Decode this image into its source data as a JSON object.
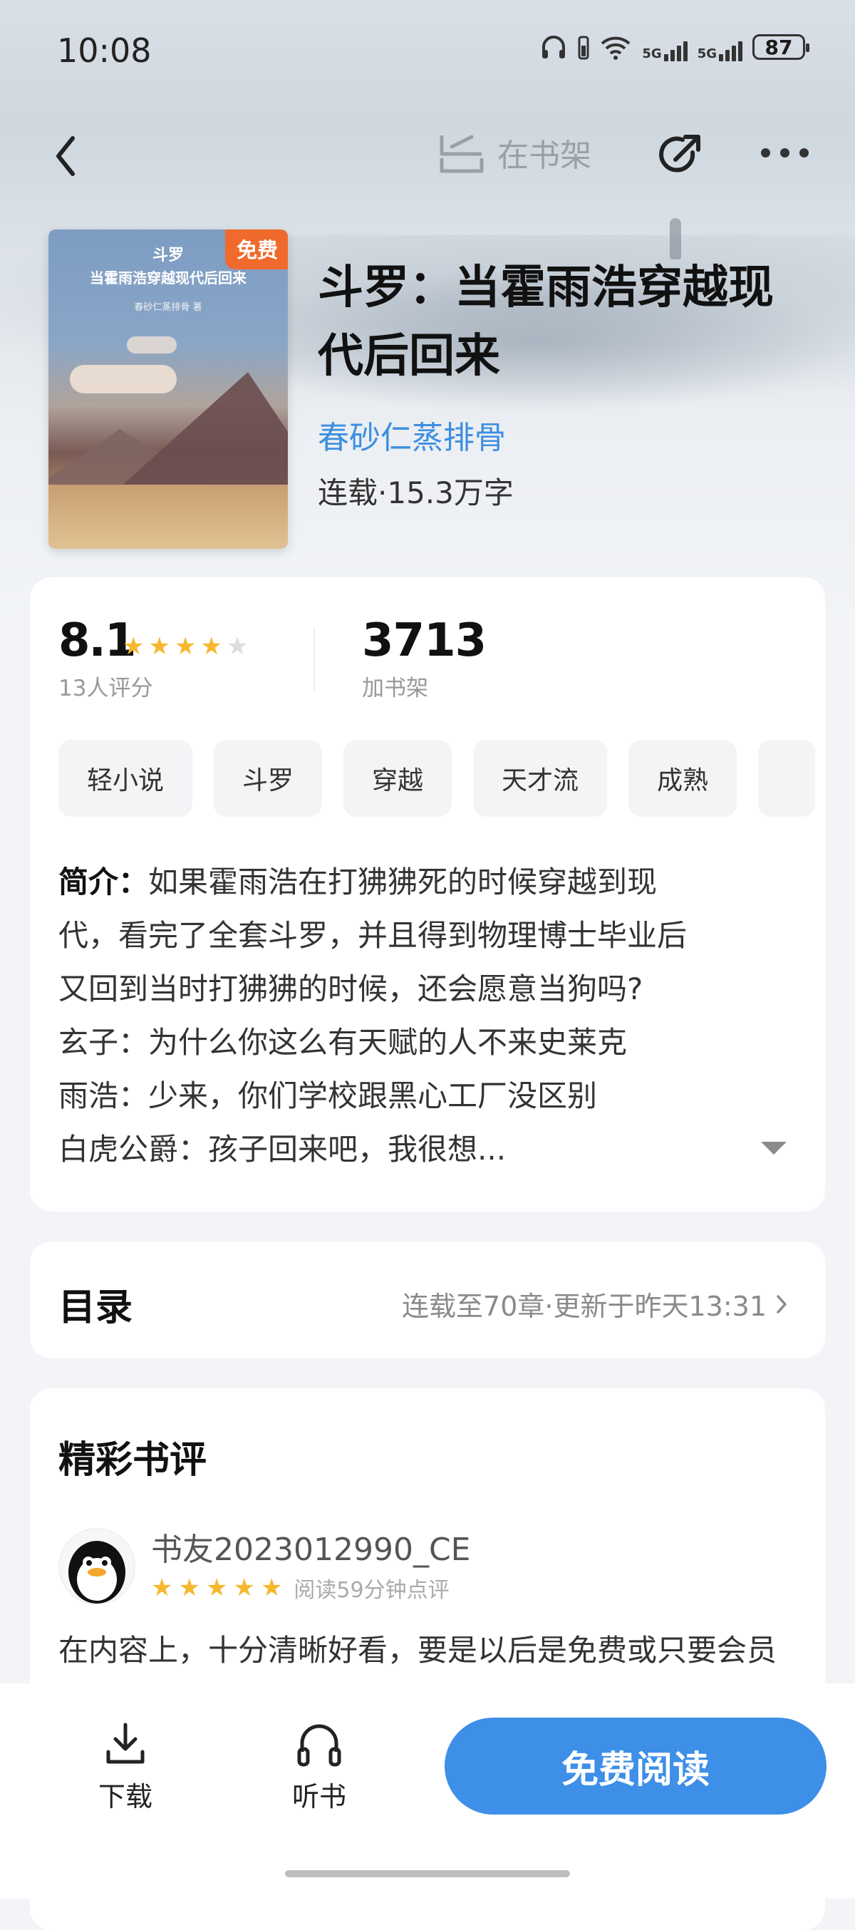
{
  "status_bar": {
    "time": "10:08",
    "battery": "87",
    "net1": "5G",
    "net2": "5G"
  },
  "nav": {
    "shelf_label": "在书架"
  },
  "book": {
    "cover_title_1": "斗罗",
    "cover_title_2": "当霍雨浩穿越现代后回来",
    "cover_author": "春砂仁蒸排骨 著",
    "free_badge": "免费",
    "title": "斗罗：当霍雨浩穿越现代后回来",
    "author": "春砂仁蒸排骨",
    "meta": "连载·15.3万字"
  },
  "stats": {
    "score": "8.1",
    "score_label": "13人评分",
    "rating_stars": 4,
    "shelf_count": "3713",
    "shelf_label": "加书架"
  },
  "tags": [
    "轻小说",
    "斗罗",
    "穿越",
    "天才流",
    "成熟"
  ],
  "intro": {
    "label": "简介：",
    "lines": [
      "如果霍雨浩在打狒狒死的时候穿越到现",
      "代，看完了全套斗罗，并且得到物理博士毕业后",
      "又回到当时打狒狒的时候，还会愿意当狗吗?",
      "玄子：为什么你这么有天赋的人不来史莱克",
      "雨浩：少来，你们学校跟黑心工厂没区别",
      "白虎公爵：孩子回来吧，我很想..."
    ]
  },
  "catalog": {
    "title": "目录",
    "info": "连载至70章·更新于昨天13:31"
  },
  "reviews": {
    "title": "精彩书评",
    "items": [
      {
        "user": "书友2023012990_CE",
        "stars": 5,
        "read_info": "阅读59分钟点评",
        "text": "在内容上，十分清晰好看，要是以后是免费或只要会员不要付费那也可以"
      }
    ]
  },
  "bottom_bar": {
    "download": "下载",
    "listen": "听书",
    "read": "免费阅读"
  },
  "colors": {
    "accent": "#3d8fe8",
    "author": "#3d8fe0",
    "star": "#f5b82e",
    "badge": "#f06a2d"
  }
}
